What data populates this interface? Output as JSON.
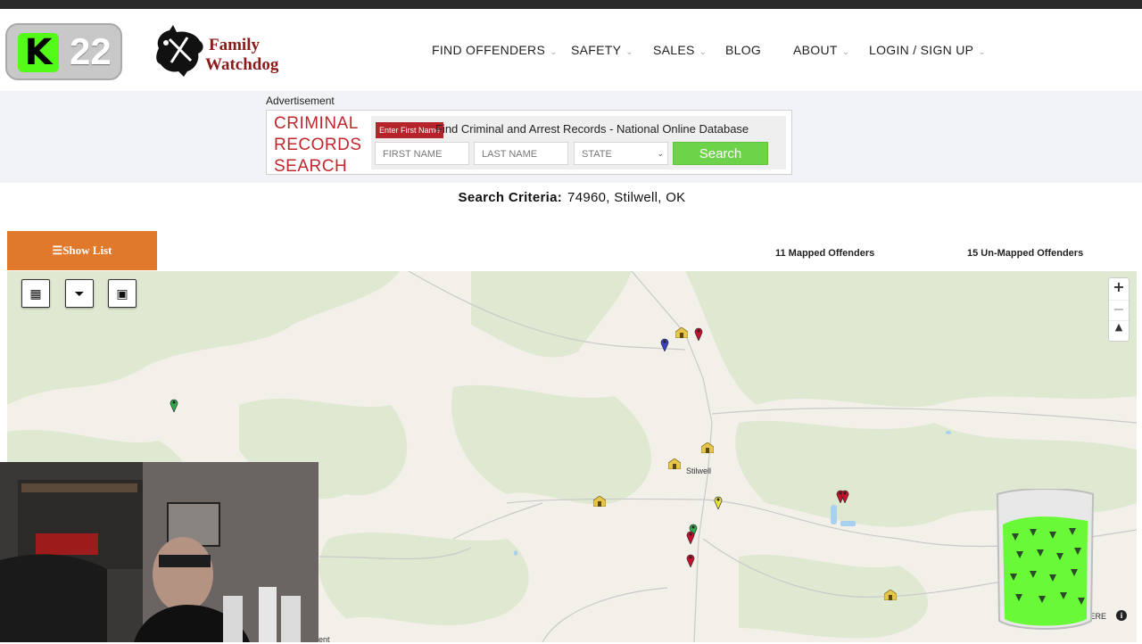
{
  "overlay": {
    "badge_number": "22",
    "badge_letter": "K"
  },
  "brand": {
    "line1": "Family",
    "line2": "Watchdog"
  },
  "nav": {
    "items": [
      {
        "label": "FIND OFFENDERS",
        "has_menu": true
      },
      {
        "label": "SAFETY",
        "has_menu": true
      },
      {
        "label": "SALES",
        "has_menu": true
      },
      {
        "label": "BLOG",
        "has_menu": false
      },
      {
        "label": "ABOUT",
        "has_menu": true
      },
      {
        "label": "LOGIN / SIGN UP",
        "has_menu": true
      }
    ],
    "chevron": "⌄"
  },
  "ad": {
    "label": "Advertisement",
    "left_lines": [
      "CRIMINAL",
      "RECORDS",
      "SEARCH"
    ],
    "tag": "Enter First Name",
    "headline": "Find Criminal and Arrest Records - National Online Database",
    "first_name_placeholder": "FIRST NAME",
    "last_name_placeholder": "LAST NAME",
    "state_placeholder": "STATE",
    "search_button": "Search",
    "accent_color": "#c0272d",
    "button_color": "#6dd44a"
  },
  "criteria": {
    "label": "Search Criteria:",
    "value": "74960, Stilwell, OK"
  },
  "list_toggle": {
    "label": "Show List",
    "color": "#e1792d"
  },
  "counts": {
    "mapped": "11 Mapped Offenders",
    "unmapped": "15 Un-Mapped Offenders"
  },
  "map": {
    "town_label": "Stilwell",
    "attribution": "HERE",
    "zoom_in": "+",
    "zoom_out": "−",
    "north": "▲",
    "controls": [
      "layers-icon",
      "filter-icon",
      "image-icon"
    ],
    "pin_colors": {
      "red": "#c8102e",
      "blue": "#3b3fc4",
      "green": "#2fa84f",
      "yellow": "#e7e03a"
    }
  },
  "footer": {
    "partial_text": "ent"
  }
}
